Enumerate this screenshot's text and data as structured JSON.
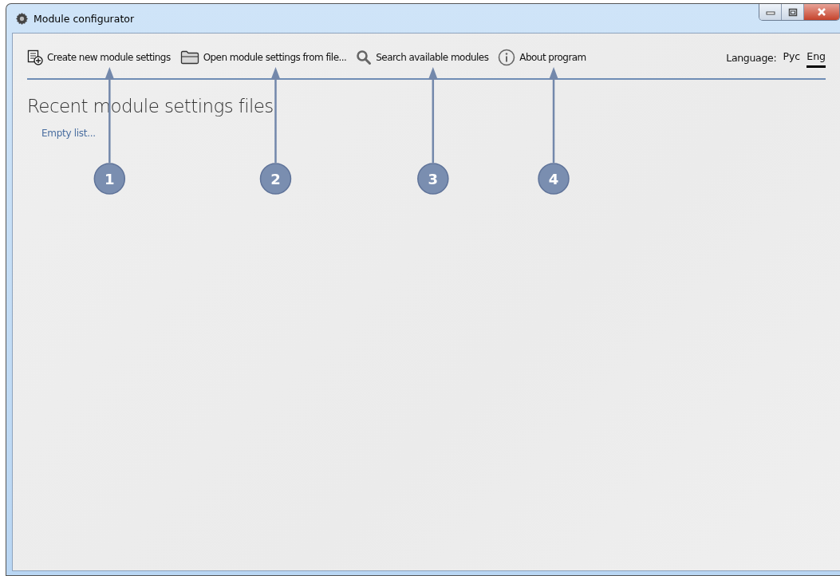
{
  "window": {
    "title": "Module configurator"
  },
  "toolbar": {
    "items": [
      {
        "kind": "create",
        "label": "Create new module settings"
      },
      {
        "kind": "open",
        "label": "Open module settings from file..."
      },
      {
        "kind": "search",
        "label": "Search available modules"
      },
      {
        "kind": "about",
        "label": "About program"
      }
    ],
    "language": {
      "label": "Language:",
      "options": [
        {
          "label": "Рус",
          "selected": false
        },
        {
          "label": "Eng",
          "selected": true
        }
      ]
    }
  },
  "recent": {
    "heading": "Recent module settings files",
    "empty_text": "Empty list..."
  },
  "callouts": [
    {
      "number": "1"
    },
    {
      "number": "2"
    },
    {
      "number": "3"
    },
    {
      "number": "4"
    }
  ]
}
